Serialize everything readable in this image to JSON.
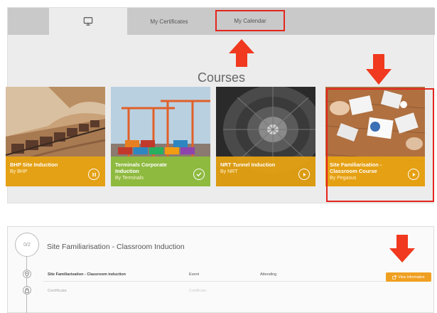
{
  "tabs": {
    "home_icon": "monitor-icon",
    "my_certificates": "My Certificates",
    "my_calendar": "My Calendar"
  },
  "section_title": "Courses",
  "courses": [
    {
      "title": "BHP Site Induction",
      "by": "By BHP",
      "status_icon": "pause-icon",
      "caption_color": "#e8a410"
    },
    {
      "title": "Terminals Corporate Induction",
      "by": "By Terminals",
      "status_icon": "check-icon",
      "caption_color": "#8ebe3c"
    },
    {
      "title": "NRT Tunnel Induction",
      "by": "By NRT",
      "status_icon": "play-icon",
      "caption_color": "#e8a410"
    },
    {
      "title": "Site Familiarisation - Classroom Course",
      "by": "By Pegasus",
      "status_icon": "play-icon",
      "caption_color": "#e8a410"
    }
  ],
  "detail": {
    "progress": "0/2",
    "heading": "Site Familiarisation - Classroom Induction",
    "rows": [
      {
        "name": "Site Familiarisation - Classroom induction",
        "type": "Event",
        "status": "Attending",
        "icon": "location-pin-icon"
      },
      {
        "name": "Certificate",
        "type": "Certificate",
        "status": "",
        "icon": "lock-icon"
      }
    ],
    "view_button": "View Information"
  },
  "colors": {
    "annotation_red": "#e3261c",
    "arrow_red": "#f0391e",
    "button_orange": "#f0a020"
  }
}
